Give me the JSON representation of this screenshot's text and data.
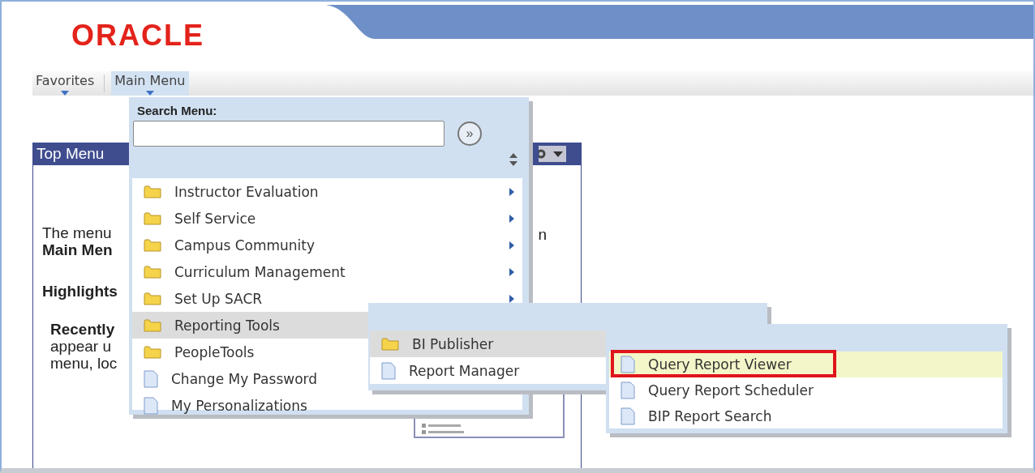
{
  "header": {
    "logo": "ORACLE"
  },
  "nav": [
    {
      "label": "Favorites",
      "selected": false
    },
    {
      "label": "Main Menu",
      "selected": true
    }
  ],
  "pagelet": {
    "title": "Top Menu",
    "left_texts": [
      {
        "text": "The menu",
        "bold": false,
        "indent": false
      },
      {
        "text": "Main Men",
        "bold": true,
        "indent": false
      },
      {
        "text": "Highlights",
        "bold": true,
        "indent": false
      },
      {
        "text": "Recently",
        "bold": true,
        "indent": true
      },
      {
        "text": "appear u",
        "bold": false,
        "indent": true
      },
      {
        "text": "menu, loc",
        "bold": false,
        "indent": true
      }
    ],
    "right_text": "n"
  },
  "main_menu": {
    "search_label": "Search Menu:",
    "go_button": "»",
    "items": [
      {
        "label": "Instructor Evaluation",
        "kind": "folder",
        "arrow": true,
        "selected": false
      },
      {
        "label": "Self Service",
        "kind": "folder",
        "arrow": true,
        "selected": false
      },
      {
        "label": "Campus Community",
        "kind": "folder",
        "arrow": true,
        "selected": false
      },
      {
        "label": "Curriculum Management",
        "kind": "folder",
        "arrow": true,
        "selected": false
      },
      {
        "label": "Set Up SACR",
        "kind": "folder",
        "arrow": true,
        "selected": false
      },
      {
        "label": "Reporting Tools",
        "kind": "folder",
        "arrow": false,
        "selected": true
      },
      {
        "label": "PeopleTools",
        "kind": "folder",
        "arrow": false,
        "selected": false
      },
      {
        "label": "Change My Password",
        "kind": "page",
        "arrow": false,
        "selected": false
      },
      {
        "label": "My Personalizations",
        "kind": "page",
        "arrow": false,
        "selected": false
      }
    ]
  },
  "submenu": {
    "items": [
      {
        "label": "BI Publisher",
        "kind": "folder",
        "selected": true
      },
      {
        "label": "Report Manager",
        "kind": "page",
        "selected": false
      }
    ]
  },
  "report_menu": {
    "items": [
      {
        "label": "Query Report Viewer",
        "kind": "page",
        "selected": true,
        "annotated": true
      },
      {
        "label": "Query Report Scheduler",
        "kind": "page",
        "selected": false,
        "annotated": false
      },
      {
        "label": "BIP Report Search",
        "kind": "page",
        "selected": false,
        "annotated": false
      }
    ]
  }
}
